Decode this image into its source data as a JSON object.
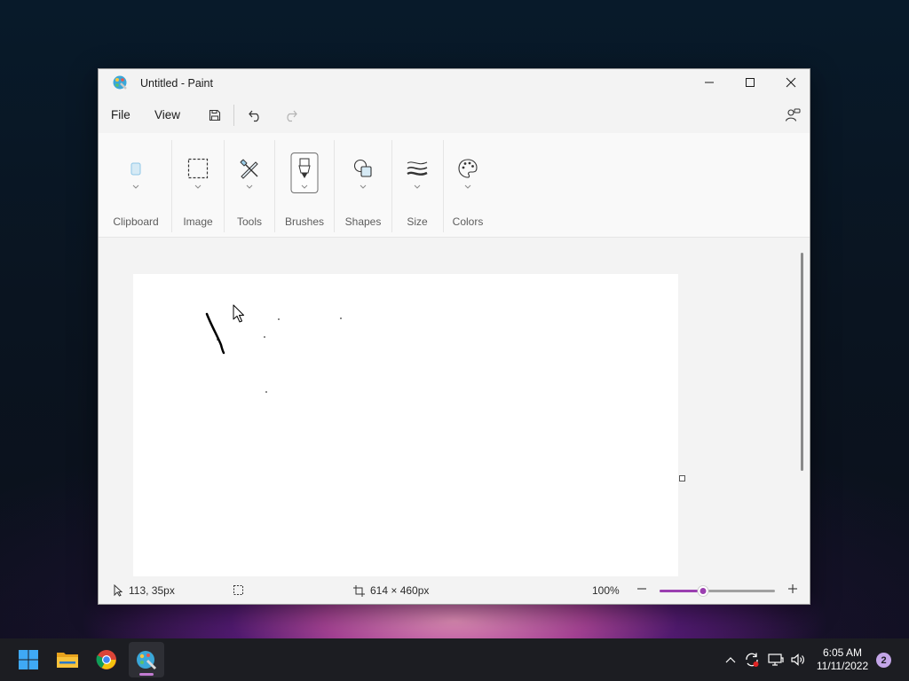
{
  "window": {
    "title": "Untitled - Paint"
  },
  "menubar": {
    "file_label": "File",
    "view_label": "View",
    "icons": [
      "save-icon",
      "undo-icon",
      "redo-icon",
      "account-icon"
    ]
  },
  "ribbon": {
    "groups": [
      {
        "label": "Clipboard",
        "icon": "clipboard-icon"
      },
      {
        "label": "Image",
        "icon": "selection-icon"
      },
      {
        "label": "Tools",
        "icon": "tools-icon"
      },
      {
        "label": "Brushes",
        "icon": "brush-icon"
      },
      {
        "label": "Shapes",
        "icon": "shapes-icon"
      },
      {
        "label": "Size",
        "icon": "size-icon"
      },
      {
        "label": "Colors",
        "icon": "palette-icon"
      }
    ]
  },
  "status": {
    "cursor_position": "113, 35px",
    "canvas_size": "614 × 460px",
    "zoom_label": "100%",
    "zoom_level": 0.38
  },
  "taskbar": {
    "apps": [
      "windows-start-icon",
      "file-explorer-icon",
      "chrome-icon",
      "paint-icon"
    ],
    "tray": [
      "chevron-up-icon",
      "sync-icon",
      "network-icon",
      "volume-icon"
    ],
    "time": "6:05 AM",
    "date": "11/11/2022",
    "notifications": "2"
  },
  "colors": {
    "accent": "#9b3fb0",
    "taskbar": "#1c1d22"
  }
}
